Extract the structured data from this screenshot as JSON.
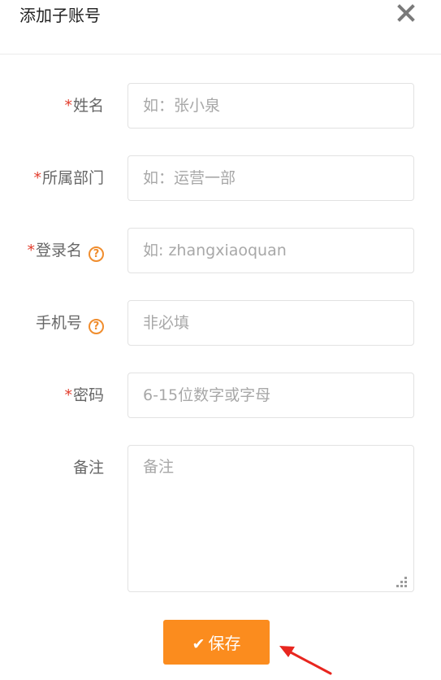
{
  "dialog": {
    "title": "添加子账号",
    "close_icon": "close-icon"
  },
  "form": {
    "name": {
      "required_mark": "*",
      "label": "姓名",
      "placeholder": "如：张小泉"
    },
    "department": {
      "required_mark": "*",
      "label": "所属部门",
      "placeholder": "如：运营一部"
    },
    "login_name": {
      "required_mark": "*",
      "label": "登录名",
      "help": "?",
      "placeholder": "如: zhangxiaoquan"
    },
    "phone": {
      "label": "手机号",
      "help": "?",
      "placeholder": "非必填"
    },
    "password": {
      "required_mark": "*",
      "label": "密码",
      "placeholder": "6-15位数字或字母"
    },
    "remark": {
      "label": "备注",
      "placeholder": "备注"
    }
  },
  "actions": {
    "save_icon": "✔",
    "save_label": "保存"
  },
  "colors": {
    "accent": "#fb8c1e",
    "required": "#e23e2d",
    "help": "#f08d2e",
    "annotation_arrow": "#e8261f"
  }
}
